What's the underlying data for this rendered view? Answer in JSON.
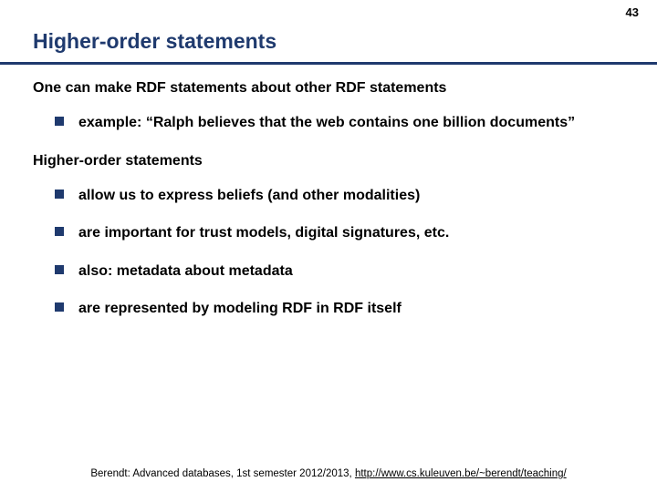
{
  "page_number": "43",
  "title": "Higher-order statements",
  "section1": {
    "heading": "One can make RDF statements about other RDF statements",
    "items": [
      "example: “Ralph believes that the web contains one billion documents”"
    ]
  },
  "section2": {
    "heading": "Higher-order statements",
    "items": [
      "allow us to express beliefs (and other modalities)",
      "are important for trust models, digital signatures, etc.",
      "also: metadata about metadata",
      "are represented by modeling RDF in RDF itself"
    ]
  },
  "footer": {
    "text": "Berendt: Advanced databases, 1st semester 2012/2013, ",
    "link_text": "http://www.cs.kuleuven.be/~berendt/teaching/",
    "link_href": "http://www.cs.kuleuven.be/~berendt/teaching/"
  }
}
